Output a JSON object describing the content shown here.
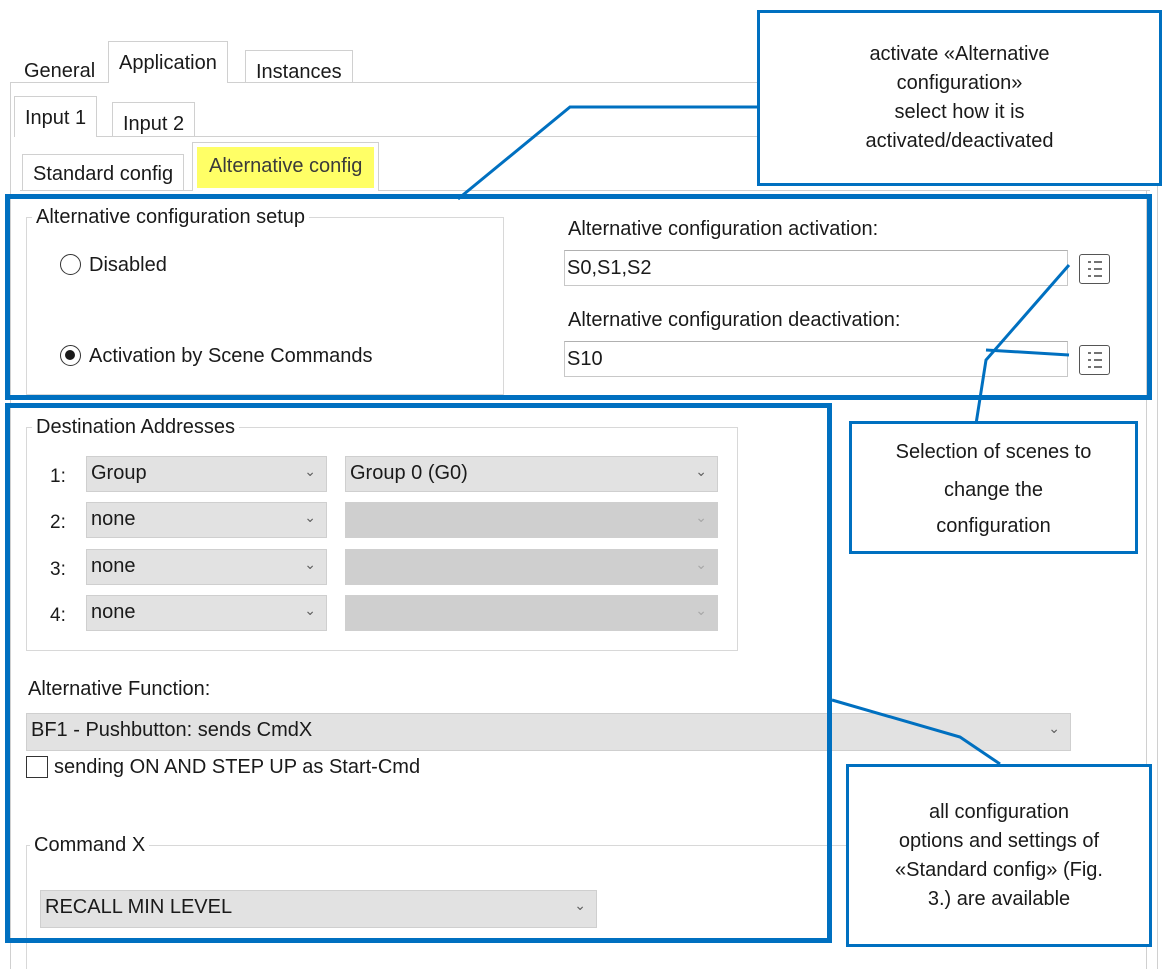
{
  "tabs_top": [
    "General",
    "Application",
    "Instances"
  ],
  "tabs_input": [
    "Input 1",
    "Input 2"
  ],
  "tabs_config": [
    "Standard config",
    "Alternative config"
  ],
  "setup": {
    "title": "Alternative configuration setup",
    "disabled_label": "Disabled",
    "scene_label": "Activation by Scene Commands",
    "activation_label": "Alternative configuration activation:",
    "activation_value": "S0,S1,S2",
    "deactivation_label": "Alternative configuration deactivation:",
    "deactivation_value": "S10"
  },
  "destinations": {
    "title": "Destination Addresses",
    "rows": [
      {
        "num": "1:",
        "type": "Group",
        "target": "Group 0 (G0)"
      },
      {
        "num": "2:",
        "type": "none",
        "target": ""
      },
      {
        "num": "3:",
        "type": "none",
        "target": ""
      },
      {
        "num": "4:",
        "type": "none",
        "target": ""
      }
    ]
  },
  "alt_function": {
    "label": "Alternative Function:",
    "value": "BF1 - Pushbutton:  sends CmdX",
    "checkbox_label": "sending ON AND STEP UP as Start-Cmd"
  },
  "command": {
    "title": "Command X",
    "value": "RECALL MIN LEVEL"
  },
  "callouts": {
    "top": [
      "activate «Alternative",
      "configuration»",
      "select how it is",
      "activated/deactivated"
    ],
    "middle": [
      "Selection of scenes to",
      "change the",
      "configuration"
    ],
    "bottom": [
      "all configuration",
      "options and settings of",
      "«Standard config» (Fig.",
      "3.) are available"
    ]
  },
  "colors": {
    "accent_blue": "#0070c0",
    "highlight_yellow": "#ffff66"
  }
}
